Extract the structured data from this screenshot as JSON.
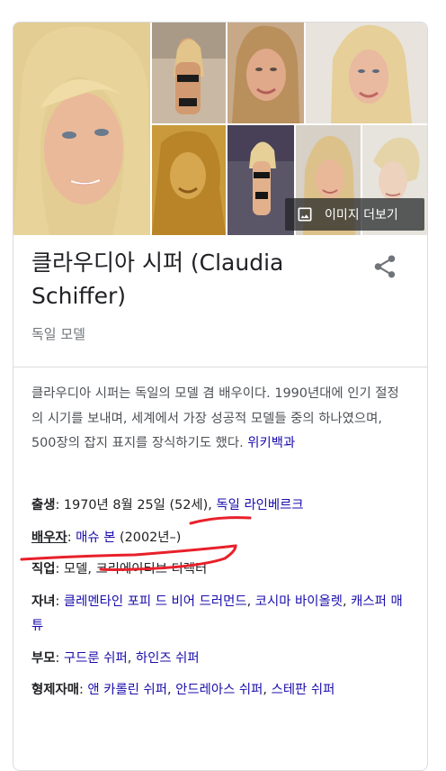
{
  "more_images": {
    "label": "이미지 더보기",
    "icon": "image-icon"
  },
  "title": "클라우디아 시퍼 (Claudia Schiffer)",
  "subtitle": "독일 모델",
  "share_icon": "share-icon",
  "description": {
    "text": "클라우디아 시퍼는 독일의 모델 겸 배우이다. 1990년대에 인기 절정의 시기를 보내며, 세계에서 가장 성공적 모델들 중의 하나였으며, 500장의 잡지 표지를 장식하기도 했다. ",
    "source_link": "위키백과"
  },
  "facts": {
    "birth": {
      "key": "출생",
      "sep": ": ",
      "date": "1970년 8월 25일 (52세), ",
      "place": "독일 라인베르크"
    },
    "spouse": {
      "key": "배우자",
      "sep": ": ",
      "name": "매슈 본",
      "years": " (2002년–)"
    },
    "occupation": {
      "key": "직업",
      "sep": ": ",
      "value": "모델, 크리에이티브 디렉터"
    },
    "children": {
      "key": "자녀",
      "sep": ": ",
      "c1": "클레멘타인 포피 드 비어 드러먼드",
      "comma1": ", ",
      "c2": "코시마 바이올렛",
      "comma2": ", ",
      "c3": "캐스퍼 매튜"
    },
    "parents": {
      "key": "부모",
      "sep": ": ",
      "p1": "구드룬 쉬퍼",
      "comma": ", ",
      "p2": "하인즈 쉬퍼"
    },
    "siblings": {
      "key": "형제자매",
      "sep": ": ",
      "s1": "앤 카롤린 쉬퍼",
      "comma1": ", ",
      "s2": "안드레아스 쉬퍼",
      "comma2": ", ",
      "s3": "스테판 쉬퍼"
    }
  },
  "colors": {
    "link": "#1a0dab",
    "annotation_red": "#e8202a"
  }
}
